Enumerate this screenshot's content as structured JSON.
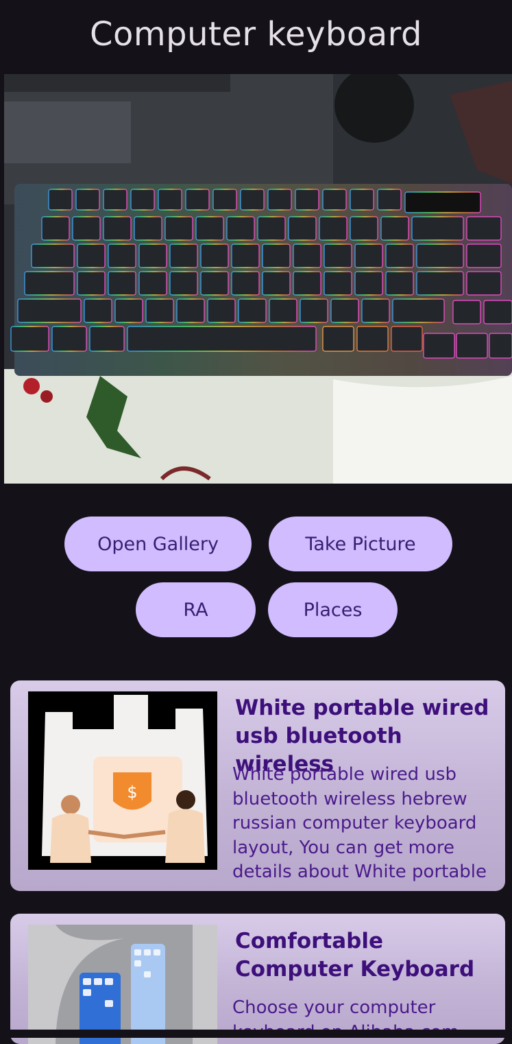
{
  "header": {
    "title": "Computer keyboard"
  },
  "hero": {
    "alt": "keyboard-photo"
  },
  "actions": {
    "open_gallery": "Open Gallery",
    "take_picture": "Take Picture",
    "ra": "RA",
    "places": "Places"
  },
  "results": [
    {
      "title": "White portable wired usb bluetooth wireless",
      "description": "White portable wired usb bluetooth wireless hebrew russian computer keyboard layout, You can get more details about White portable"
    },
    {
      "title": "Comfortable Computer Keyboard",
      "description": "Choose your computer keyboard on Alibaba.com"
    }
  ],
  "colors": {
    "background": "#141218",
    "button": "#d0bcff",
    "button_text": "#381e72",
    "card_title": "#3d0f7a"
  }
}
